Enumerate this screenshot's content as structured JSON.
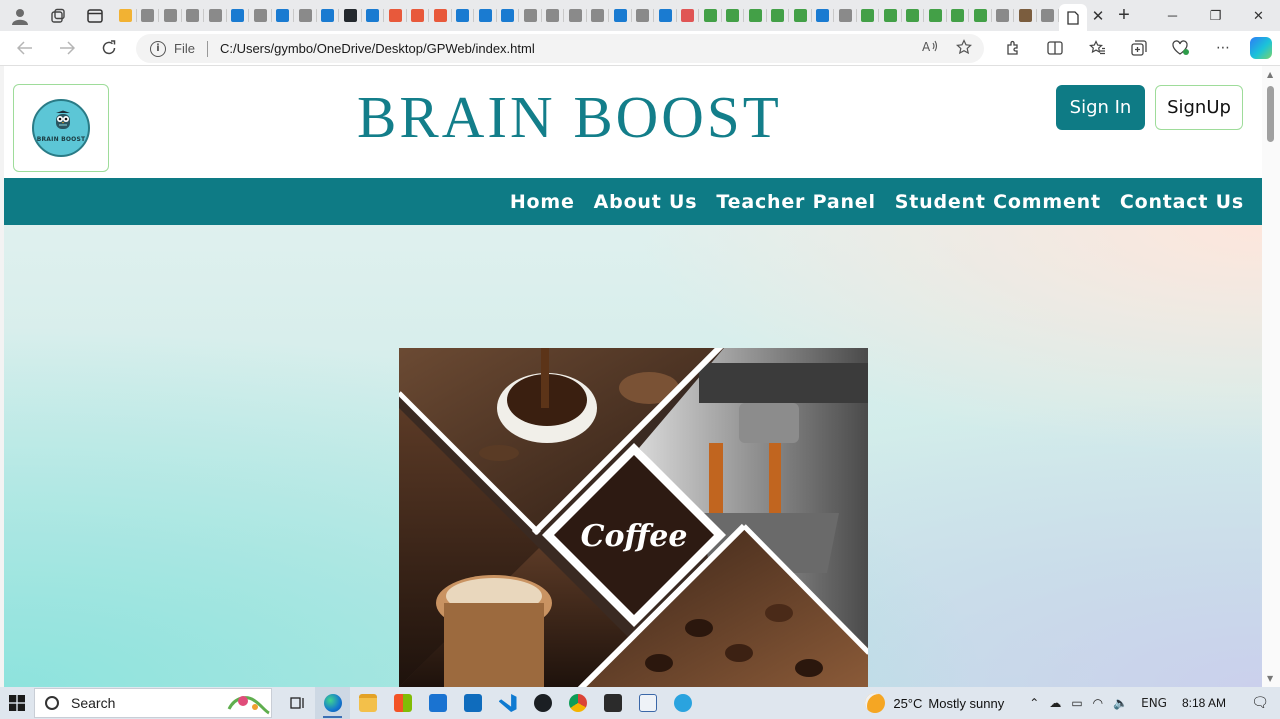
{
  "browser": {
    "address": {
      "protocol_label": "File",
      "url": "C:/Users/gymbo/OneDrive/Desktop/GPWeb/index.html"
    },
    "window_controls": {
      "minimize": "─",
      "restore": "❐",
      "close": "✕"
    },
    "tab_close": "✕",
    "new_tab": "+"
  },
  "site": {
    "brand_title": "BRAIN BOOST",
    "logo_text": "BRAIN BOOST",
    "buttons": {
      "sign_in": "Sign In",
      "sign_up": "SignUp"
    },
    "nav": [
      "Home",
      "About Us",
      "Teacher Panel",
      "Student Comment",
      "Contact Us"
    ],
    "hero_image_text": "Coffee",
    "colors": {
      "primary": "#0e7b85",
      "button_border": "#9edc9a"
    }
  },
  "taskbar": {
    "search_placeholder": "Search",
    "weather": {
      "temp": "25°C",
      "condition": "Mostly sunny"
    },
    "language": "ENG",
    "time": "8:18 AM"
  }
}
